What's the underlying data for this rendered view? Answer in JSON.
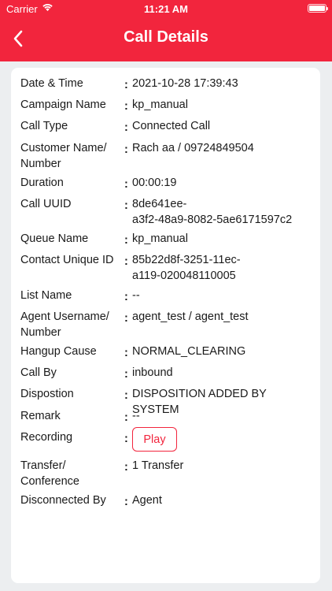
{
  "status_bar": {
    "carrier": "Carrier",
    "time": "11:21 AM",
    "icons": [
      "wifi-icon",
      "battery-icon"
    ]
  },
  "header": {
    "title": "Call Details",
    "back_icon": "chevron-left-icon",
    "background_color": "#f2253d"
  },
  "colon": ":",
  "details": [
    {
      "label": "Date & Time",
      "value": "2021-10-28 17:39:43"
    },
    {
      "label": "Campaign Name",
      "value": "kp_manual"
    },
    {
      "label": "Call Type",
      "value": "Connected Call"
    },
    {
      "label": "Customer Name/\nNumber",
      "value": "Rach aa / 09724849504"
    },
    {
      "label": "Duration",
      "value": "00:00:19"
    },
    {
      "label": "Call UUID",
      "value": "8de641ee-\na3f2-48a9-8082-5ae6171597c2"
    },
    {
      "label": "Queue Name",
      "value": "kp_manual"
    },
    {
      "label": "Contact Unique ID",
      "value": "85b22d8f-3251-11ec-\na119-020048110005"
    },
    {
      "label": "List Name",
      "value": "--"
    },
    {
      "label": "Agent Username/\nNumber",
      "value": "agent_test / agent_test"
    },
    {
      "label": "Hangup Cause",
      "value": "NORMAL_CLEARING"
    },
    {
      "label": "Call By",
      "value": "inbound"
    },
    {
      "label": "Dispostion",
      "value": "DISPOSITION ADDED BY SYSTEM"
    },
    {
      "label": "Remark",
      "value": "--"
    },
    {
      "label": "Recording",
      "button_label": "Play"
    },
    {
      "label": "Transfer/\nConference",
      "value": "1 Transfer"
    },
    {
      "label": "Disconnected By",
      "value": "Agent"
    }
  ]
}
